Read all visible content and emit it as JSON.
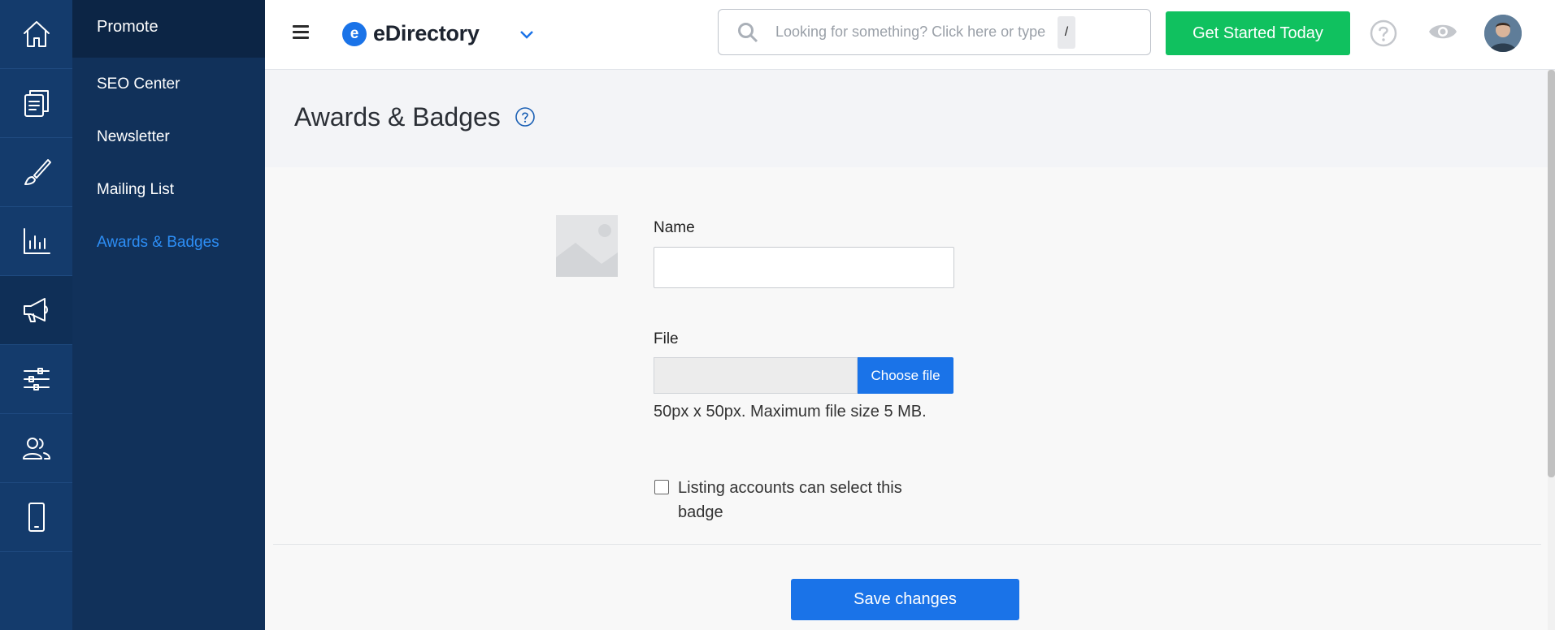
{
  "rail": {
    "icons": [
      "home-icon",
      "pages-icon",
      "brush-icon",
      "chart-icon",
      "megaphone-icon",
      "sliders-icon",
      "users-icon",
      "mobile-icon"
    ],
    "active_index": 4
  },
  "submenu": {
    "title": "Promote",
    "items": [
      {
        "label": "SEO Center"
      },
      {
        "label": "Newsletter"
      },
      {
        "label": "Mailing List"
      },
      {
        "label": "Awards & Badges"
      }
    ],
    "active_index": 3
  },
  "topbar": {
    "brand_letter": "e",
    "brand_name": "eDirectory",
    "search_placeholder": "Looking for something? Click here or type",
    "search_shortcut": "/",
    "cta_label": "Get Started Today"
  },
  "page": {
    "title": "Awards & Badges"
  },
  "form": {
    "name_label": "Name",
    "name_value": "",
    "file_label": "File",
    "choose_file_label": "Choose file",
    "file_hint": "50px x 50px. Maximum file size 5 MB.",
    "checkbox_label": "Listing accounts can select this badge",
    "checkbox_checked": false,
    "save_label": "Save changes"
  },
  "colors": {
    "rail": "#143b6c",
    "submenu": "#11315a",
    "accent": "#1a73e8",
    "cta": "#10c15f",
    "active_link": "#2d8ef5"
  }
}
